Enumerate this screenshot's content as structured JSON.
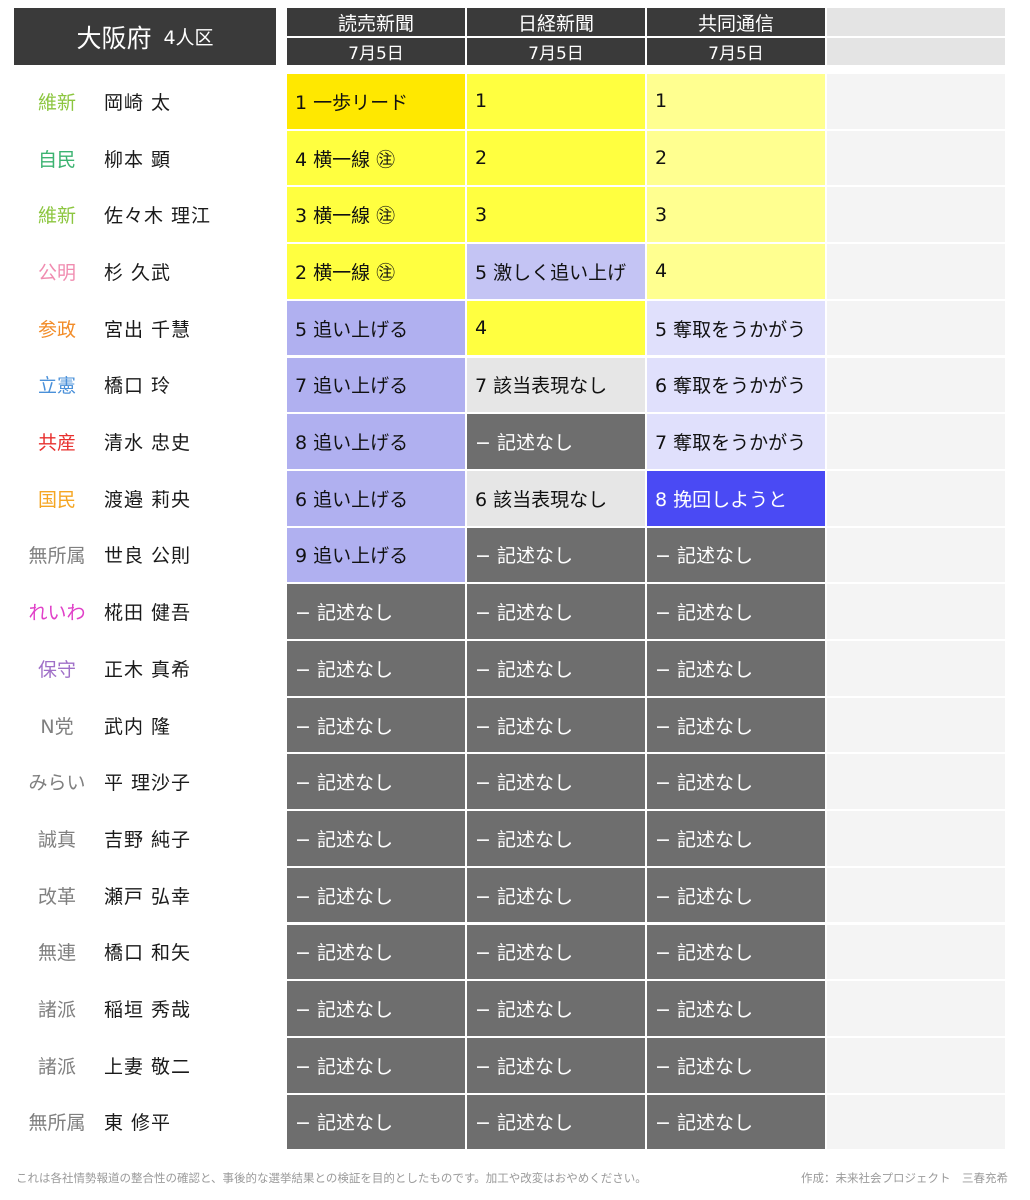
{
  "title": {
    "prefecture": "大阪府",
    "seats": "4人区"
  },
  "columns": [
    {
      "name": "読売新聞",
      "date": "7月5日"
    },
    {
      "name": "日経新聞",
      "date": "7月5日"
    },
    {
      "name": "共同通信",
      "date": "7月5日"
    }
  ],
  "rows": [
    {
      "party": "維新",
      "party_color": "#8cc63f",
      "candidate": "岡崎 太",
      "cells": [
        {
          "text": "1 一歩リード",
          "bg": "#ffe800"
        },
        {
          "text": "1",
          "bg": "#ffff40"
        },
        {
          "text": "1",
          "bg": "#ffff90"
        }
      ]
    },
    {
      "party": "自民",
      "party_color": "#3cb371",
      "candidate": "柳本 顕",
      "cells": [
        {
          "text": "4 横一線 ㊟",
          "bg": "#ffff40"
        },
        {
          "text": "2",
          "bg": "#ffff40"
        },
        {
          "text": "2",
          "bg": "#ffff90"
        }
      ]
    },
    {
      "party": "維新",
      "party_color": "#8cc63f",
      "candidate": "佐々木 理江",
      "cells": [
        {
          "text": "3 横一線 ㊟",
          "bg": "#ffff40"
        },
        {
          "text": "3",
          "bg": "#ffff40"
        },
        {
          "text": "3",
          "bg": "#ffff90"
        }
      ]
    },
    {
      "party": "公明",
      "party_color": "#f08cb0",
      "candidate": "杉 久武",
      "cells": [
        {
          "text": "2 横一線 ㊟",
          "bg": "#ffff40"
        },
        {
          "text": "5 激しく追い上げ",
          "bg": "#c4c4f4"
        },
        {
          "text": "4",
          "bg": "#ffff90"
        }
      ]
    },
    {
      "party": "参政",
      "party_color": "#f28c28",
      "candidate": "宮出 千慧",
      "cells": [
        {
          "text": "5 追い上げる",
          "bg": "#b0b0f0"
        },
        {
          "text": "4",
          "bg": "#ffff40"
        },
        {
          "text": "5 奪取をうかがう",
          "bg": "#e0e0fc"
        }
      ]
    },
    {
      "party": "立憲",
      "party_color": "#4a90d9",
      "candidate": "橋口 玲",
      "cells": [
        {
          "text": "7 追い上げる",
          "bg": "#b0b0f0"
        },
        {
          "text": "7 該当表現なし",
          "bg": "#e6e6e6"
        },
        {
          "text": "6 奪取をうかがう",
          "bg": "#e0e0fc"
        }
      ]
    },
    {
      "party": "共産",
      "party_color": "#e8302e",
      "candidate": "清水 忠史",
      "cells": [
        {
          "text": "8 追い上げる",
          "bg": "#b0b0f0"
        },
        {
          "text": "− 記述なし",
          "bg": "#6e6e6e",
          "nodesc": true
        },
        {
          "text": "7 奪取をうかがう",
          "bg": "#e0e0fc"
        }
      ]
    },
    {
      "party": "国民",
      "party_color": "#f5a623",
      "candidate": "渡邉 莉央",
      "cells": [
        {
          "text": "6 追い上げる",
          "bg": "#b0b0f0"
        },
        {
          "text": "6 該当表現なし",
          "bg": "#e6e6e6"
        },
        {
          "text": "8 挽回しようと",
          "bg": "#4a4af4",
          "deepblue": true
        }
      ]
    },
    {
      "party": "無所属",
      "party_color": "#808080",
      "candidate": "世良 公則",
      "cells": [
        {
          "text": "9 追い上げる",
          "bg": "#b0b0f0"
        },
        {
          "text": "− 記述なし",
          "bg": "#6e6e6e",
          "nodesc": true
        },
        {
          "text": "− 記述なし",
          "bg": "#6e6e6e",
          "nodesc": true
        }
      ]
    },
    {
      "party": "れいわ",
      "party_color": "#e040c8",
      "candidate": "椛田 健吾",
      "cells": [
        {
          "text": "− 記述なし",
          "bg": "#6e6e6e",
          "nodesc": true
        },
        {
          "text": "− 記述なし",
          "bg": "#6e6e6e",
          "nodesc": true
        },
        {
          "text": "− 記述なし",
          "bg": "#6e6e6e",
          "nodesc": true
        }
      ]
    },
    {
      "party": "保守",
      "party_color": "#a070c8",
      "candidate": "正木 真希",
      "cells": [
        {
          "text": "− 記述なし",
          "bg": "#6e6e6e",
          "nodesc": true
        },
        {
          "text": "− 記述なし",
          "bg": "#6e6e6e",
          "nodesc": true
        },
        {
          "text": "− 記述なし",
          "bg": "#6e6e6e",
          "nodesc": true
        }
      ]
    },
    {
      "party": "N党",
      "party_color": "#808080",
      "candidate": "武内 隆",
      "cells": [
        {
          "text": "− 記述なし",
          "bg": "#6e6e6e",
          "nodesc": true
        },
        {
          "text": "− 記述なし",
          "bg": "#6e6e6e",
          "nodesc": true
        },
        {
          "text": "− 記述なし",
          "bg": "#6e6e6e",
          "nodesc": true
        }
      ]
    },
    {
      "party": "みらい",
      "party_color": "#808080",
      "candidate": "平 理沙子",
      "cells": [
        {
          "text": "− 記述なし",
          "bg": "#6e6e6e",
          "nodesc": true
        },
        {
          "text": "− 記述なし",
          "bg": "#6e6e6e",
          "nodesc": true
        },
        {
          "text": "− 記述なし",
          "bg": "#6e6e6e",
          "nodesc": true
        }
      ]
    },
    {
      "party": "誠真",
      "party_color": "#808080",
      "candidate": "吉野 純子",
      "cells": [
        {
          "text": "− 記述なし",
          "bg": "#6e6e6e",
          "nodesc": true
        },
        {
          "text": "− 記述なし",
          "bg": "#6e6e6e",
          "nodesc": true
        },
        {
          "text": "− 記述なし",
          "bg": "#6e6e6e",
          "nodesc": true
        }
      ]
    },
    {
      "party": "改革",
      "party_color": "#808080",
      "candidate": "瀬戸 弘幸",
      "cells": [
        {
          "text": "− 記述なし",
          "bg": "#6e6e6e",
          "nodesc": true
        },
        {
          "text": "− 記述なし",
          "bg": "#6e6e6e",
          "nodesc": true
        },
        {
          "text": "− 記述なし",
          "bg": "#6e6e6e",
          "nodesc": true
        }
      ]
    },
    {
      "party": "無連",
      "party_color": "#808080",
      "candidate": "橋口 和矢",
      "cells": [
        {
          "text": "− 記述なし",
          "bg": "#6e6e6e",
          "nodesc": true
        },
        {
          "text": "− 記述なし",
          "bg": "#6e6e6e",
          "nodesc": true
        },
        {
          "text": "− 記述なし",
          "bg": "#6e6e6e",
          "nodesc": true
        }
      ]
    },
    {
      "party": "諸派",
      "party_color": "#808080",
      "candidate": "稲垣 秀哉",
      "cells": [
        {
          "text": "− 記述なし",
          "bg": "#6e6e6e",
          "nodesc": true
        },
        {
          "text": "− 記述なし",
          "bg": "#6e6e6e",
          "nodesc": true
        },
        {
          "text": "− 記述なし",
          "bg": "#6e6e6e",
          "nodesc": true
        }
      ]
    },
    {
      "party": "諸派",
      "party_color": "#808080",
      "candidate": "上妻 敬二",
      "cells": [
        {
          "text": "− 記述なし",
          "bg": "#6e6e6e",
          "nodesc": true
        },
        {
          "text": "− 記述なし",
          "bg": "#6e6e6e",
          "nodesc": true
        },
        {
          "text": "− 記述なし",
          "bg": "#6e6e6e",
          "nodesc": true
        }
      ]
    },
    {
      "party": "無所属",
      "party_color": "#808080",
      "candidate": "東 修平",
      "cells": [
        {
          "text": "− 記述なし",
          "bg": "#6e6e6e",
          "nodesc": true
        },
        {
          "text": "− 記述なし",
          "bg": "#6e6e6e",
          "nodesc": true
        },
        {
          "text": "− 記述なし",
          "bg": "#6e6e6e",
          "nodesc": true
        }
      ]
    }
  ],
  "footer": {
    "note": "これは各社情勢報道の整合性の確認と、事後的な選挙結果との検証を目的としたものです。加工や改変はおやめください。",
    "credit": "作成：未来社会プロジェクト　三春充希"
  },
  "colors": {
    "header_bg": "#3a3a3a",
    "empty_col": "#f4f4f4",
    "no_description": "#6e6e6e"
  }
}
